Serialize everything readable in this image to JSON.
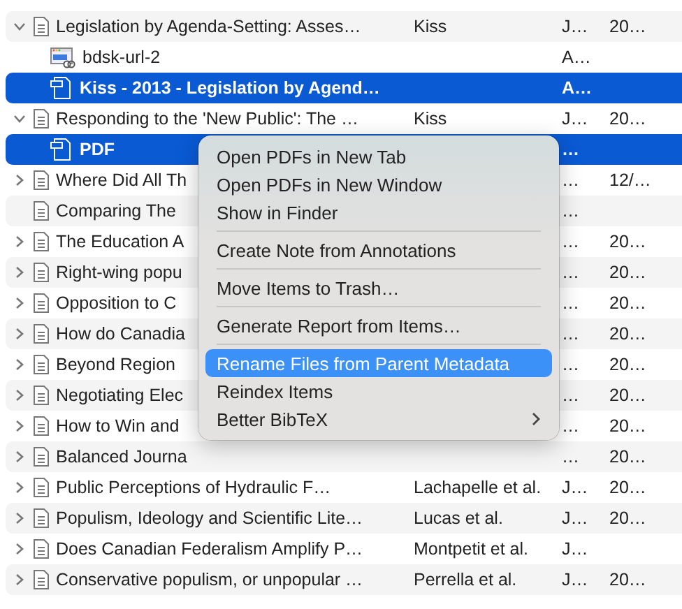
{
  "rows": [
    {
      "kind": "parent",
      "expanded": true,
      "selected": false,
      "title": "Legislation by Agenda-Setting: Asses…",
      "creator": "Kiss",
      "column_3": "J…",
      "column_4": "20…"
    },
    {
      "kind": "link",
      "selected": false,
      "title": "bdsk-url-2",
      "column_3": "A…"
    },
    {
      "kind": "file",
      "selected": true,
      "title": "Kiss - 2013 - Legislation by Agend…",
      "column_3": "A…"
    },
    {
      "kind": "parent",
      "expanded": true,
      "selected": false,
      "title": "Responding to the 'New Public': The …",
      "creator": "Kiss",
      "column_3": "J…",
      "column_4": "20…"
    },
    {
      "kind": "file",
      "selected": true,
      "title": "PDF",
      "column_3": "…"
    },
    {
      "kind": "parent",
      "expanded": false,
      "selected": false,
      "title": "Where Did All Th",
      "column_3": "…",
      "column_4": "12/…"
    },
    {
      "kind": "leaf",
      "selected": false,
      "title": "Comparing The",
      "column_3": "…"
    },
    {
      "kind": "parent",
      "expanded": false,
      "selected": false,
      "title": "The Education A",
      "column_3": "…",
      "column_4": "20…"
    },
    {
      "kind": "parent",
      "expanded": false,
      "selected": false,
      "title": "Right-wing popu",
      "column_3": "…",
      "column_4": "20…"
    },
    {
      "kind": "parent",
      "expanded": false,
      "selected": false,
      "title": "Opposition to C",
      "column_3": "…",
      "column_4": "20…"
    },
    {
      "kind": "parent",
      "expanded": false,
      "selected": false,
      "title": "How do Canadia",
      "column_3": "…",
      "column_4": "20…"
    },
    {
      "kind": "parent",
      "expanded": false,
      "selected": false,
      "title": "Beyond Region",
      "column_3": "…",
      "column_4": "20…"
    },
    {
      "kind": "parent",
      "expanded": false,
      "selected": false,
      "title": "Negotiating Elec",
      "column_3": "…",
      "column_4": "20…"
    },
    {
      "kind": "parent",
      "expanded": false,
      "selected": false,
      "title": "How to Win and",
      "column_3": "…",
      "column_4": "20…"
    },
    {
      "kind": "parent",
      "expanded": false,
      "selected": false,
      "title": "Balanced Journa",
      "column_3": "…",
      "column_4": "20…"
    },
    {
      "kind": "parent",
      "expanded": false,
      "selected": false,
      "title": "Public Perceptions of Hydraulic F…",
      "creator": "Lachapelle et al.",
      "column_3": "J…",
      "column_4": "20…"
    },
    {
      "kind": "parent",
      "expanded": false,
      "selected": false,
      "title": "Populism, Ideology and Scientific Lite…",
      "creator": "Lucas et al.",
      "column_3": "J…",
      "column_4": "20…"
    },
    {
      "kind": "parent",
      "expanded": false,
      "selected": false,
      "title": "Does Canadian Federalism Amplify P…",
      "creator": "Montpetit et al.",
      "column_3": "J…"
    },
    {
      "kind": "parent",
      "expanded": false,
      "selected": false,
      "title": "Conservative populism, or unpopular …",
      "creator": "Perrella et al.",
      "column_3": "J…",
      "column_4": "20…"
    }
  ],
  "context_menu": [
    {
      "kind": "item",
      "label": "Open PDFs in New Tab",
      "selected": false
    },
    {
      "kind": "item",
      "label": "Open PDFs in New Window",
      "selected": false
    },
    {
      "kind": "item",
      "label": "Show in Finder",
      "selected": false
    },
    {
      "kind": "separator"
    },
    {
      "kind": "item",
      "label": "Create Note from Annotations",
      "selected": false
    },
    {
      "kind": "separator"
    },
    {
      "kind": "item",
      "label": "Move Items to Trash…",
      "selected": false
    },
    {
      "kind": "separator"
    },
    {
      "kind": "item",
      "label": "Generate Report from Items…",
      "selected": false
    },
    {
      "kind": "separator"
    },
    {
      "kind": "item",
      "label": "Rename Files from Parent Metadata",
      "selected": true
    },
    {
      "kind": "item",
      "label": "Reindex Items",
      "selected": false
    },
    {
      "kind": "submenu",
      "label": "Better BibTeX",
      "selected": false
    }
  ]
}
